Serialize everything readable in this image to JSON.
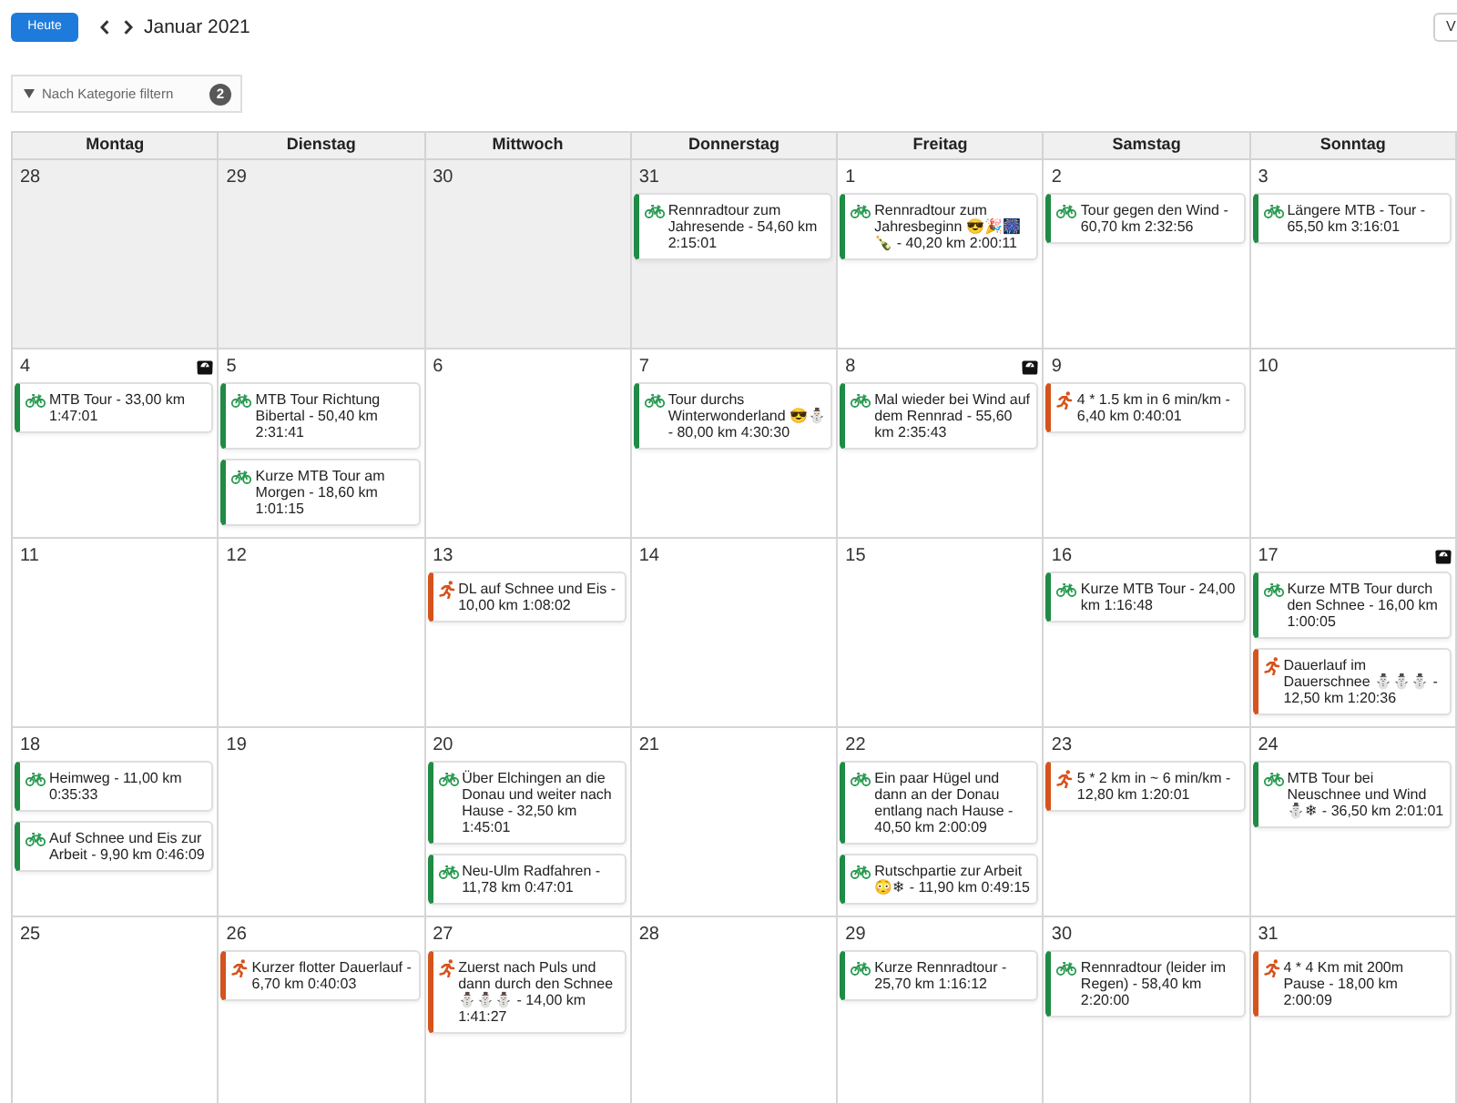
{
  "toolbar": {
    "today_button": "Heute",
    "month_label": "Januar 2021",
    "view_button": "V"
  },
  "filter": {
    "label": "Nach Kategorie filtern",
    "count": "2"
  },
  "weekdays": [
    "Montag",
    "Dienstag",
    "Mittwoch",
    "Donnerstag",
    "Freitag",
    "Samstag",
    "Sonntag"
  ],
  "weeks": [
    {
      "days": [
        {
          "date": "28",
          "other_month": true,
          "scale_marker": false
        },
        {
          "date": "29",
          "other_month": true,
          "scale_marker": false
        },
        {
          "date": "30",
          "other_month": true,
          "scale_marker": false
        },
        {
          "date": "31",
          "other_month": true,
          "scale_marker": false,
          "events": [
            {
              "kind": "cycling",
              "text": "Rennradtour zum Jahresende - 54,60 km 2:15:01"
            }
          ]
        },
        {
          "date": "1",
          "other_month": false,
          "scale_marker": false,
          "events": [
            {
              "kind": "cycling",
              "text": "Rennradtour zum Jahresbeginn 😎🎉🎆🍾 - 40,20 km 2:00:11"
            }
          ]
        },
        {
          "date": "2",
          "other_month": false,
          "scale_marker": false,
          "events": [
            {
              "kind": "cycling",
              "text": "Tour gegen den Wind - 60,70 km 2:32:56"
            }
          ]
        },
        {
          "date": "3",
          "other_month": false,
          "scale_marker": false,
          "events": [
            {
              "kind": "cycling",
              "text": "Längere MTB - Tour - 65,50 km 3:16:01"
            }
          ]
        }
      ]
    },
    {
      "days": [
        {
          "date": "4",
          "other_month": false,
          "scale_marker": true,
          "events": [
            {
              "kind": "cycling",
              "text": "MTB Tour - 33,00 km 1:47:01"
            }
          ]
        },
        {
          "date": "5",
          "other_month": false,
          "scale_marker": false,
          "events": [
            {
              "kind": "cycling",
              "text": "MTB Tour Richtung Bibertal - 50,40 km 2:31:41"
            },
            {
              "kind": "cycling",
              "text": "Kurze MTB Tour am Morgen - 18,60 km 1:01:15"
            }
          ]
        },
        {
          "date": "6",
          "other_month": false,
          "scale_marker": false
        },
        {
          "date": "7",
          "other_month": false,
          "scale_marker": false,
          "events": [
            {
              "kind": "cycling",
              "text": "Tour durchs Winterwonderland 😎⛄ - 80,00 km 4:30:30"
            }
          ]
        },
        {
          "date": "8",
          "other_month": false,
          "scale_marker": true,
          "events": [
            {
              "kind": "cycling",
              "text": "Mal wieder bei Wind auf dem Rennrad - 55,60 km 2:35:43"
            }
          ]
        },
        {
          "date": "9",
          "other_month": false,
          "scale_marker": false,
          "events": [
            {
              "kind": "running",
              "text": "4 * 1.5 km in 6 min/km - 6,40 km 0:40:01"
            }
          ]
        },
        {
          "date": "10",
          "other_month": false,
          "scale_marker": false
        }
      ]
    },
    {
      "days": [
        {
          "date": "11",
          "other_month": false,
          "scale_marker": false
        },
        {
          "date": "12",
          "other_month": false,
          "scale_marker": false
        },
        {
          "date": "13",
          "other_month": false,
          "scale_marker": false,
          "events": [
            {
              "kind": "running",
              "text": "DL auf Schnee und Eis - 10,00 km 1:08:02"
            }
          ]
        },
        {
          "date": "14",
          "other_month": false,
          "scale_marker": false
        },
        {
          "date": "15",
          "other_month": false,
          "scale_marker": false
        },
        {
          "date": "16",
          "other_month": false,
          "scale_marker": false,
          "events": [
            {
              "kind": "cycling",
              "text": "Kurze MTB Tour - 24,00 km 1:16:48"
            }
          ]
        },
        {
          "date": "17",
          "other_month": false,
          "scale_marker": true,
          "events": [
            {
              "kind": "cycling",
              "text": "Kurze MTB Tour durch den Schnee - 16,00 km 1:00:05"
            },
            {
              "kind": "running",
              "text": "Dauerlauf im Dauerschnee ⛄⛄⛄ - 12,50 km 1:20:36"
            }
          ]
        }
      ]
    },
    {
      "days": [
        {
          "date": "18",
          "other_month": false,
          "scale_marker": false,
          "events": [
            {
              "kind": "cycling",
              "text": "Heimweg - 11,00 km 0:35:33"
            },
            {
              "kind": "cycling",
              "text": "Auf Schnee und Eis zur Arbeit - 9,90 km 0:46:09"
            }
          ]
        },
        {
          "date": "19",
          "other_month": false,
          "scale_marker": false
        },
        {
          "date": "20",
          "other_month": false,
          "scale_marker": false,
          "events": [
            {
              "kind": "cycling",
              "text": "Über Elchingen an die Donau und weiter nach Hause - 32,50 km 1:45:01"
            },
            {
              "kind": "cycling",
              "text": "Neu-Ulm Radfahren - 11,78 km 0:47:01"
            }
          ]
        },
        {
          "date": "21",
          "other_month": false,
          "scale_marker": false
        },
        {
          "date": "22",
          "other_month": false,
          "scale_marker": false,
          "events": [
            {
              "kind": "cycling",
              "text": "Ein paar Hügel und dann an der Donau entlang nach Hause - 40,50 km 2:00:09"
            },
            {
              "kind": "cycling",
              "text": "Rutschpartie zur Arbeit 😳❄ - 11,90 km 0:49:15"
            }
          ]
        },
        {
          "date": "23",
          "other_month": false,
          "scale_marker": false,
          "events": [
            {
              "kind": "running",
              "text": "5 * 2 km in ~ 6 min/km - 12,80 km 1:20:01"
            }
          ]
        },
        {
          "date": "24",
          "other_month": false,
          "scale_marker": false,
          "events": [
            {
              "kind": "cycling",
              "text": "MTB Tour bei Neuschnee und Wind ⛄❄ - 36,50 km 2:01:01"
            }
          ]
        }
      ]
    },
    {
      "days": [
        {
          "date": "25",
          "other_month": false,
          "scale_marker": false
        },
        {
          "date": "26",
          "other_month": false,
          "scale_marker": false,
          "events": [
            {
              "kind": "running",
              "text": "Kurzer flotter Dauerlauf - 6,70 km 0:40:03"
            }
          ]
        },
        {
          "date": "27",
          "other_month": false,
          "scale_marker": false,
          "events": [
            {
              "kind": "running",
              "text": "Zuerst nach Puls und dann durch den Schnee ⛄⛄⛄ - 14,00 km 1:41:27"
            }
          ]
        },
        {
          "date": "28",
          "other_month": false,
          "scale_marker": false
        },
        {
          "date": "29",
          "other_month": false,
          "scale_marker": false,
          "events": [
            {
              "kind": "cycling",
              "text": "Kurze Rennradtour - 25,70 km 1:16:12"
            }
          ]
        },
        {
          "date": "30",
          "other_month": false,
          "scale_marker": false,
          "events": [
            {
              "kind": "cycling",
              "text": "Rennradtour (leider im Regen) - 58,40 km 2:20:00"
            }
          ]
        },
        {
          "date": "31",
          "other_month": false,
          "scale_marker": false,
          "events": [
            {
              "kind": "running",
              "text": "4 * 4 Km mit 200m Pause - 18,00 km 2:00:09"
            }
          ]
        }
      ]
    }
  ]
}
